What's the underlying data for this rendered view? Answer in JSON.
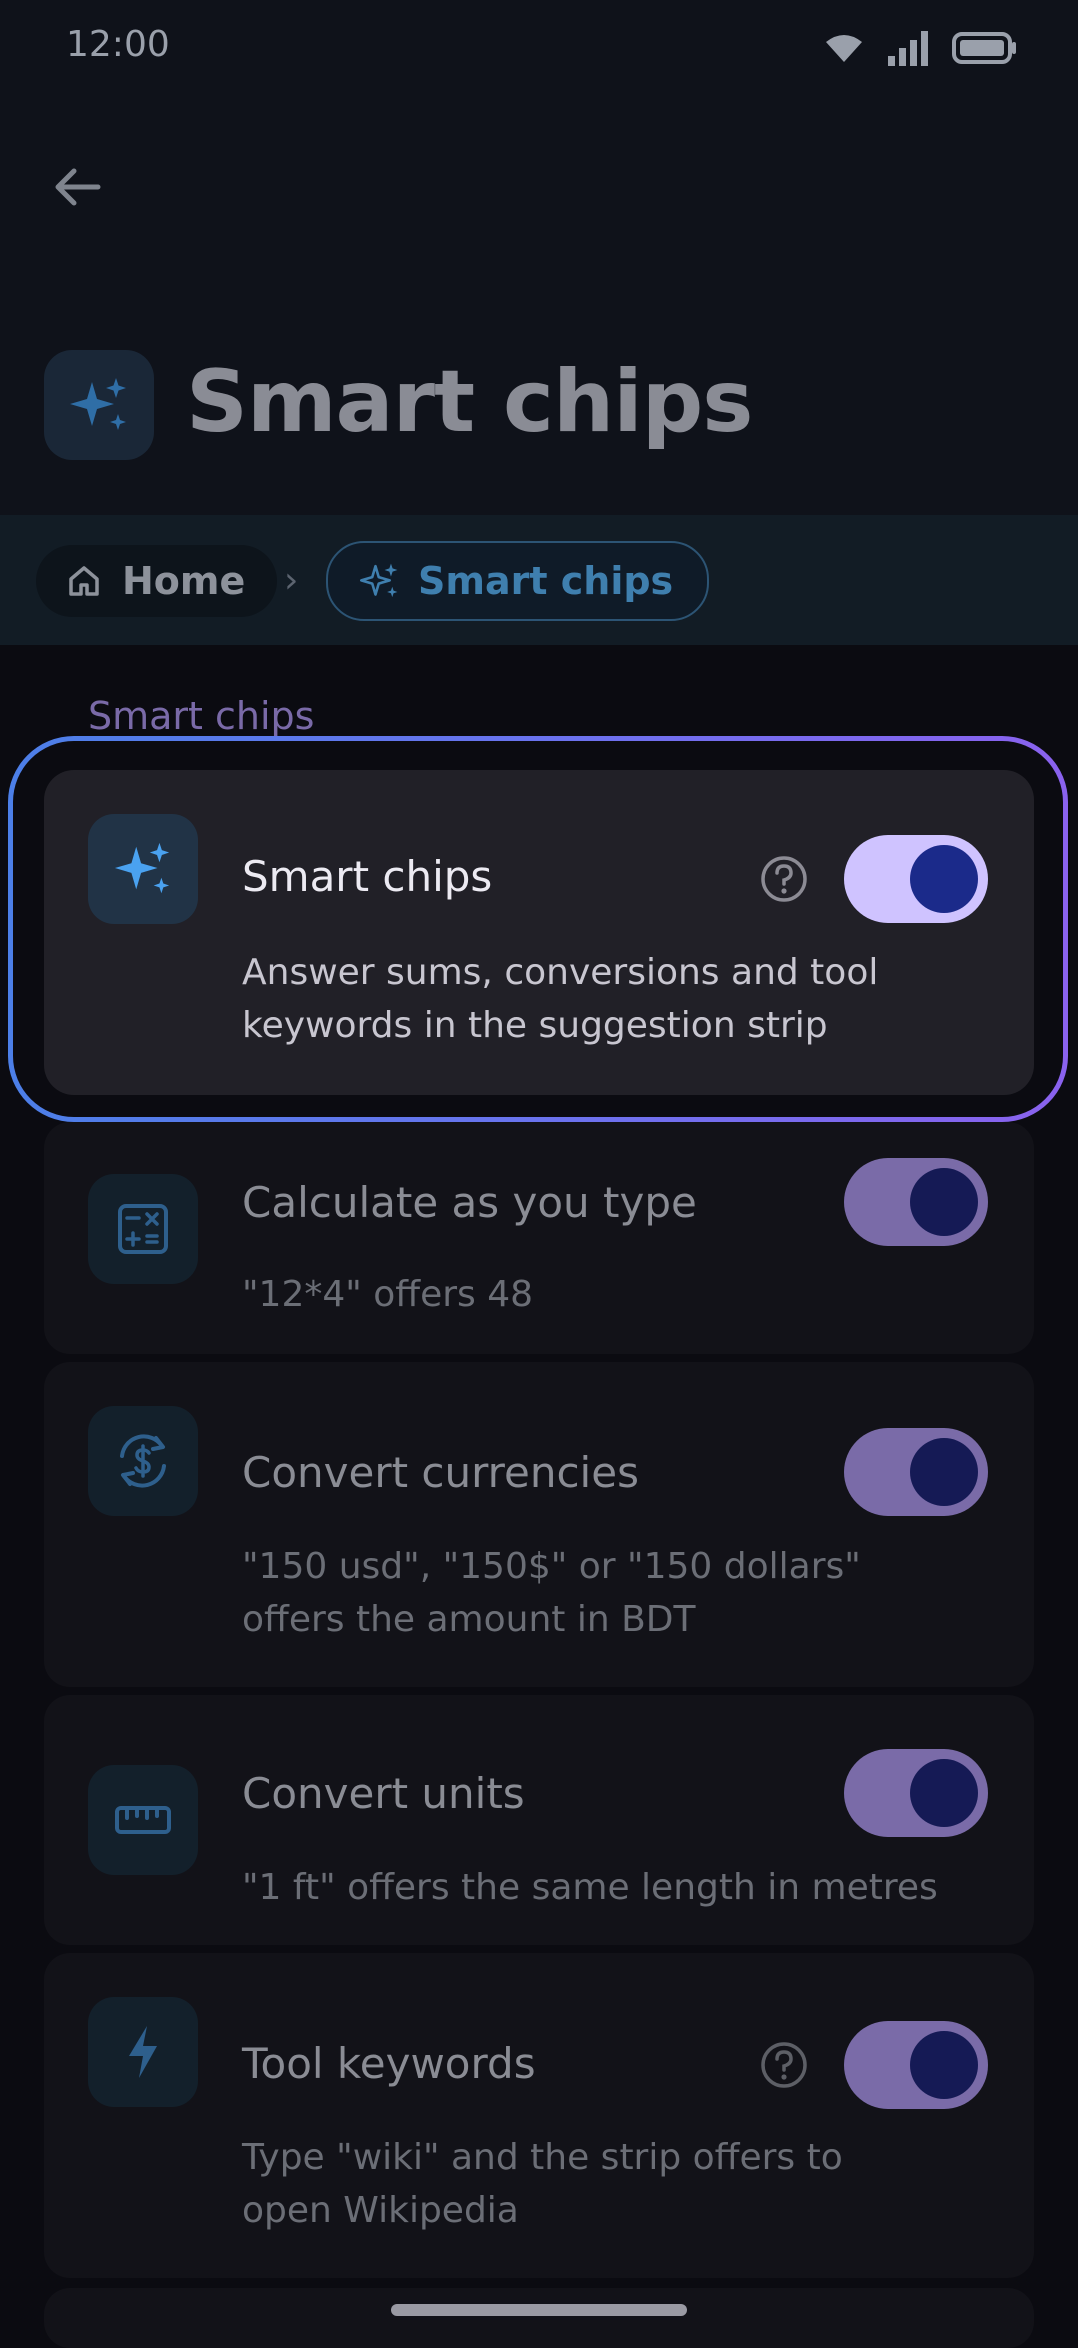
{
  "status_bar": {
    "time": "12:00",
    "icons": [
      "wifi-icon",
      "signal-icon",
      "battery-icon"
    ]
  },
  "header": {
    "title": "Smart chips",
    "icon": "sparkle-icon"
  },
  "breadcrumb": {
    "home_label": "Home",
    "current_label": "Smart chips"
  },
  "section": {
    "label": "Smart chips"
  },
  "settings": [
    {
      "title": "Smart chips",
      "description": "Answer sums, conversions and tool keywords in the suggestion strip",
      "enabled": true,
      "has_help": true,
      "icon": "sparkle-icon"
    },
    {
      "title": "Calculate as you type",
      "description": "\"12*4\" offers 48",
      "enabled": true,
      "has_help": false,
      "icon": "calculator-icon"
    },
    {
      "title": "Convert currencies",
      "description": "\"150 usd\", \"150$\" or \"150 dollars\" offers the amount in BDT",
      "enabled": true,
      "has_help": false,
      "icon": "currency-exchange-icon"
    },
    {
      "title": "Convert units",
      "description": "\"1 ft\" offers the same length in metres",
      "enabled": true,
      "has_help": false,
      "icon": "ruler-icon"
    },
    {
      "title": "Tool keywords",
      "description": "Type \"wiki\" and the strip offers to open Wikipedia",
      "enabled": true,
      "has_help": true,
      "icon": "bolt-icon"
    }
  ],
  "colors": {
    "accent": "#7a6ba8",
    "highlight_start": "#4c7fe8",
    "highlight_end": "#8a62ee",
    "icon_blue": "#3f8de0"
  }
}
